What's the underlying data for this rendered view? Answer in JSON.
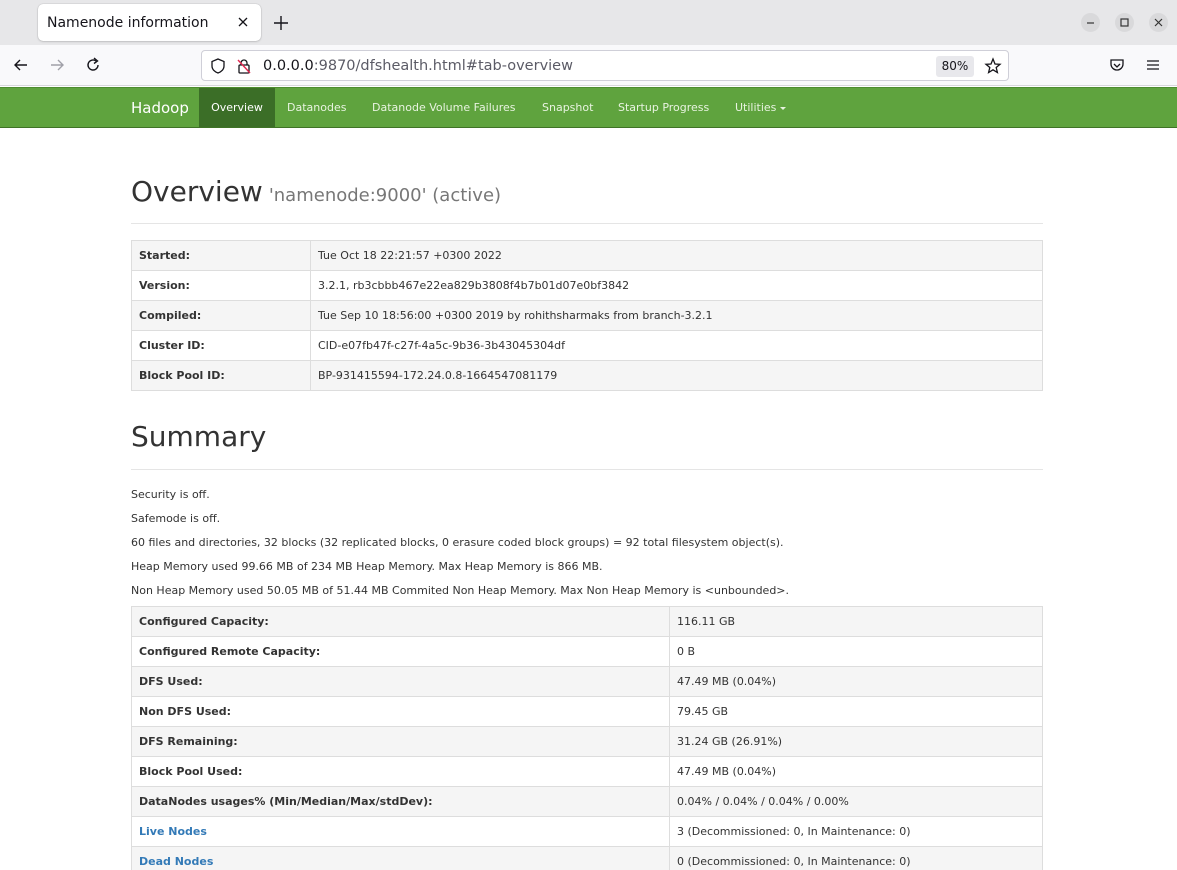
{
  "browser": {
    "tab_title": "Namenode information",
    "url_host": "0.0.0.0",
    "url_rest": ":9870/dfshealth.html#tab-overview",
    "zoom": "80%"
  },
  "nav": {
    "brand": "Hadoop",
    "items": [
      "Overview",
      "Datanodes",
      "Datanode Volume Failures",
      "Snapshot",
      "Startup Progress",
      "Utilities"
    ],
    "active": "Overview",
    "color": "#5fa33e"
  },
  "overview": {
    "title": "Overview",
    "subtitle": "'namenode:9000' (active)",
    "rows": [
      {
        "label": "Started:",
        "value": "Tue Oct 18 22:21:57 +0300 2022"
      },
      {
        "label": "Version:",
        "value": "3.2.1, rb3cbbb467e22ea829b3808f4b7b01d07e0bf3842"
      },
      {
        "label": "Compiled:",
        "value": "Tue Sep 10 18:56:00 +0300 2019 by rohithsharmaks from branch-3.2.1"
      },
      {
        "label": "Cluster ID:",
        "value": "CID-e07fb47f-c27f-4a5c-9b36-3b43045304df"
      },
      {
        "label": "Block Pool ID:",
        "value": "BP-931415594-172.24.0.8-1664547081179"
      }
    ]
  },
  "summary": {
    "title": "Summary",
    "lines": [
      "Security is off.",
      "Safemode is off.",
      "60 files and directories, 32 blocks (32 replicated blocks, 0 erasure coded block groups) = 92 total filesystem object(s).",
      "Heap Memory used 99.66 MB of 234 MB Heap Memory. Max Heap Memory is 866 MB.",
      "Non Heap Memory used 50.05 MB of 51.44 MB Commited Non Heap Memory. Max Non Heap Memory is <unbounded>."
    ],
    "rows": [
      {
        "label": "Configured Capacity:",
        "value": "116.11 GB"
      },
      {
        "label": "Configured Remote Capacity:",
        "value": "0 B"
      },
      {
        "label": "DFS Used:",
        "value": "47.49 MB (0.04%)"
      },
      {
        "label": "Non DFS Used:",
        "value": "79.45 GB"
      },
      {
        "label": "DFS Remaining:",
        "value": "31.24 GB (26.91%)"
      },
      {
        "label": "Block Pool Used:",
        "value": "47.49 MB (0.04%)"
      },
      {
        "label": "DataNodes usages% (Min/Median/Max/stdDev):",
        "value": "0.04% / 0.04% / 0.04% / 0.00%"
      },
      {
        "label": "Live Nodes",
        "value": "3 (Decommissioned: 0, In Maintenance: 0)"
      },
      {
        "label": "Dead Nodes",
        "value": "0 (Decommissioned: 0, In Maintenance: 0)"
      }
    ]
  }
}
